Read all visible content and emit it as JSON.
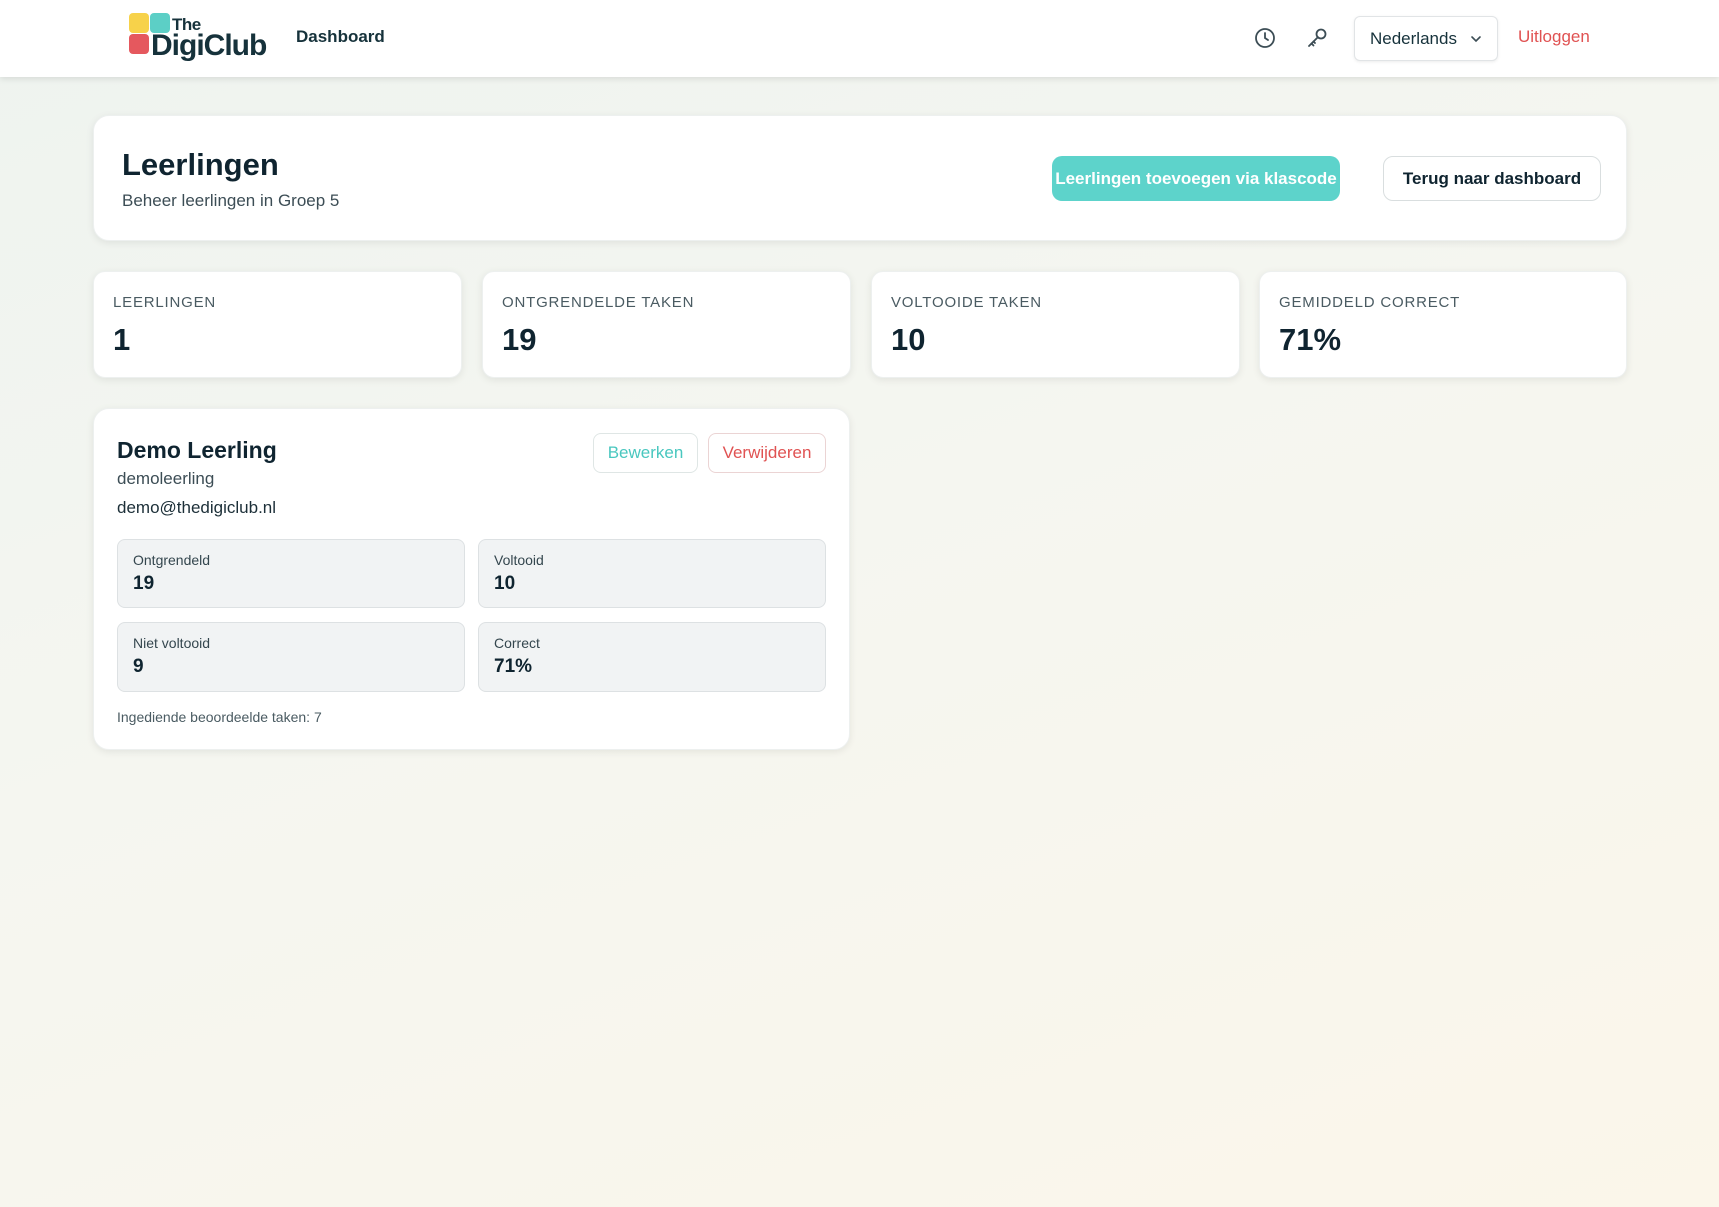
{
  "header": {
    "logo_text_small": "The",
    "logo_text_large": "DigiClub",
    "nav_dashboard": "Dashboard",
    "history_icon": "clock-icon",
    "key_icon": "key-icon",
    "language": "Nederlands",
    "logout": "Uitloggen"
  },
  "page": {
    "title": "Leerlingen",
    "subtitle": "Beheer leerlingen in Groep 5",
    "add_button": "Leerlingen toevoegen via klascode",
    "back_button": "Terug naar dashboard"
  },
  "stats": [
    {
      "label": "LEERLINGEN",
      "value": "1"
    },
    {
      "label": "ONTGRENDELDE TAKEN",
      "value": "19"
    },
    {
      "label": "VOLTOOIDE TAKEN",
      "value": "10"
    },
    {
      "label": "GEMIDDELD CORRECT",
      "value": "71%"
    }
  ],
  "student": {
    "name": "Demo Leerling",
    "username": "demoleerling",
    "email": "demo@thedigiclub.nl",
    "edit_button": "Bewerken",
    "delete_button": "Verwijderen",
    "metrics": [
      {
        "label": "Ontgrendeld",
        "value": "19"
      },
      {
        "label": "Voltooid",
        "value": "10"
      },
      {
        "label": "Niet voltooid",
        "value": "9"
      },
      {
        "label": "Correct",
        "value": "71%"
      }
    ],
    "footer": "Ingediende beoordeelde taken: 7"
  },
  "colors": {
    "accent": "#5dd3cb",
    "danger": "#e05252",
    "text": "#0f2430"
  }
}
